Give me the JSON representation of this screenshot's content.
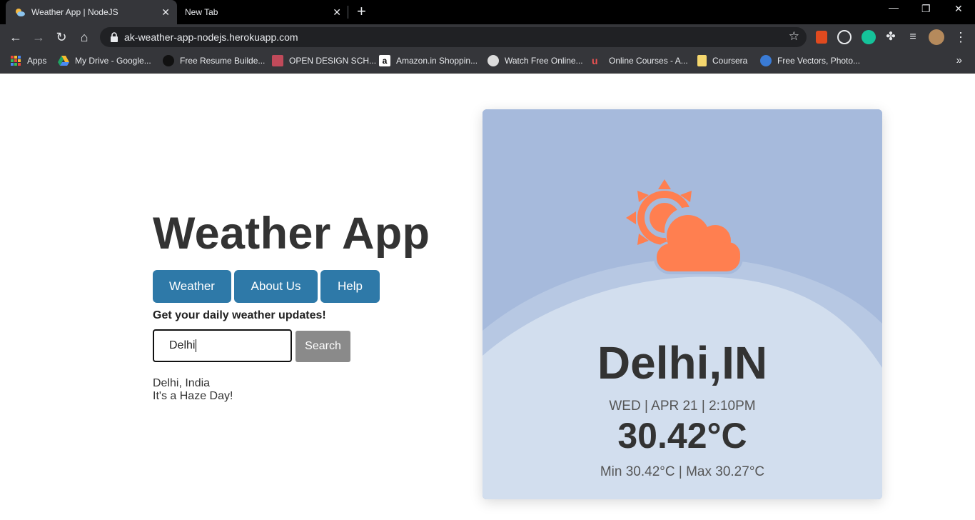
{
  "browser": {
    "tabs": [
      {
        "title": "Weather App | NodeJS",
        "active": true
      },
      {
        "title": "New Tab",
        "active": false
      }
    ],
    "url": "ak-weather-app-nodejs.herokuapp.com",
    "bookmarks": [
      {
        "label": "Apps",
        "icon": "apps-grid-icon",
        "color": "#e8453c"
      },
      {
        "label": "My Drive - Google...",
        "icon": "google-drive-icon",
        "color": "#1fa463"
      },
      {
        "label": "Free Resume Builde...",
        "icon": "resume-icon",
        "color": "#222222"
      },
      {
        "label": "OPEN DESIGN SCH...",
        "icon": "design-school-icon",
        "color": "#c04a5a"
      },
      {
        "label": "Amazon.in Shoppin...",
        "icon": "amazon-icon",
        "color": "#ffffff"
      },
      {
        "label": "Watch Free Online...",
        "icon": "globe-icon",
        "color": "#dcdcdc"
      },
      {
        "label": "Online Courses - A...",
        "icon": "udemy-icon",
        "color": "#ec5252"
      },
      {
        "label": "Coursera",
        "icon": "folder-icon",
        "color": "#f5d76e"
      },
      {
        "label": "Free Vectors, Photo...",
        "icon": "freepik-icon",
        "color": "#3a7bd5"
      }
    ]
  },
  "app": {
    "title": "Weather App",
    "nav": [
      "Weather",
      "About Us",
      "Help"
    ],
    "tagline": "Get your daily weather updates!",
    "search": {
      "value": "Delhi",
      "button": "Search"
    },
    "result": {
      "location": "Delhi, India",
      "condition": "It's a Haze Day!"
    }
  },
  "card": {
    "city": "Delhi,IN",
    "datetime": "WED | APR 21 | 2:10PM",
    "temp": "30.42°C",
    "minmax": "Min 30.42°C | Max 30.27°C",
    "icon": "partly-cloudy-icon",
    "colors": {
      "sky": "#a6badc",
      "hill": "#d2deee",
      "icon": "#ff7f50"
    }
  }
}
